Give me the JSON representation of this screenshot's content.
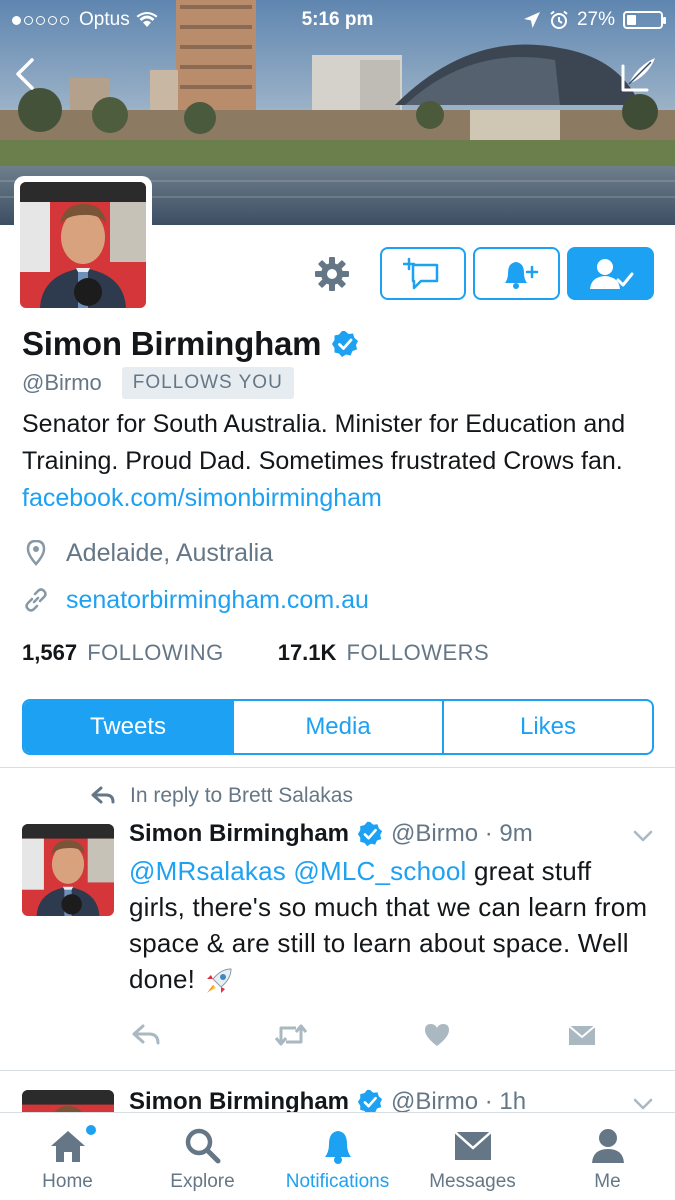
{
  "status_bar": {
    "carrier": "Optus",
    "time": "5:16 pm",
    "battery_percent_label": "27%",
    "battery_level": 0.27
  },
  "profile": {
    "name": "Simon Birmingham",
    "handle": "@Birmo",
    "follows_you": "FOLLOWS YOU",
    "bio_text": "Senator for South Australia. Minister for Education and Training. Proud Dad. Sometimes frustrated Crows fan.",
    "bio_link": "facebook.com/simonbirmingham",
    "location": "Adelaide, Australia",
    "website": "senatorbirmingham.com.au",
    "following_count": "1,567",
    "following_label": "FOLLOWING",
    "followers_count": "17.1K",
    "followers_label": "FOLLOWERS"
  },
  "tabs": [
    {
      "label": "Tweets",
      "active": true
    },
    {
      "label": "Media",
      "active": false
    },
    {
      "label": "Likes",
      "active": false
    }
  ],
  "tweet": {
    "reply_context": "In reply to Brett Salakas",
    "name": "Simon Birmingham",
    "handle_time": "@Birmo · 9m",
    "mention1": "@MRsalakas",
    "mention2": "@MLC_school",
    "text": "great stuff girls, there's so much that we can learn from space & are still to learn about space. Well done!"
  },
  "tweet2": {
    "name": "Simon Birmingham",
    "handle_time": "@Birmo · 1h"
  },
  "tabbar": [
    {
      "label": "Home",
      "icon": "home-icon",
      "active": false
    },
    {
      "label": "Explore",
      "icon": "search-icon",
      "active": false
    },
    {
      "label": "Notifications",
      "icon": "bell-icon",
      "active": true
    },
    {
      "label": "Messages",
      "icon": "envelope-icon",
      "active": false
    },
    {
      "label": "Me",
      "icon": "person-icon",
      "active": false
    }
  ],
  "colors": {
    "accent": "#1da1f2",
    "secondary_text": "#657786",
    "primary_text": "#14171a"
  }
}
